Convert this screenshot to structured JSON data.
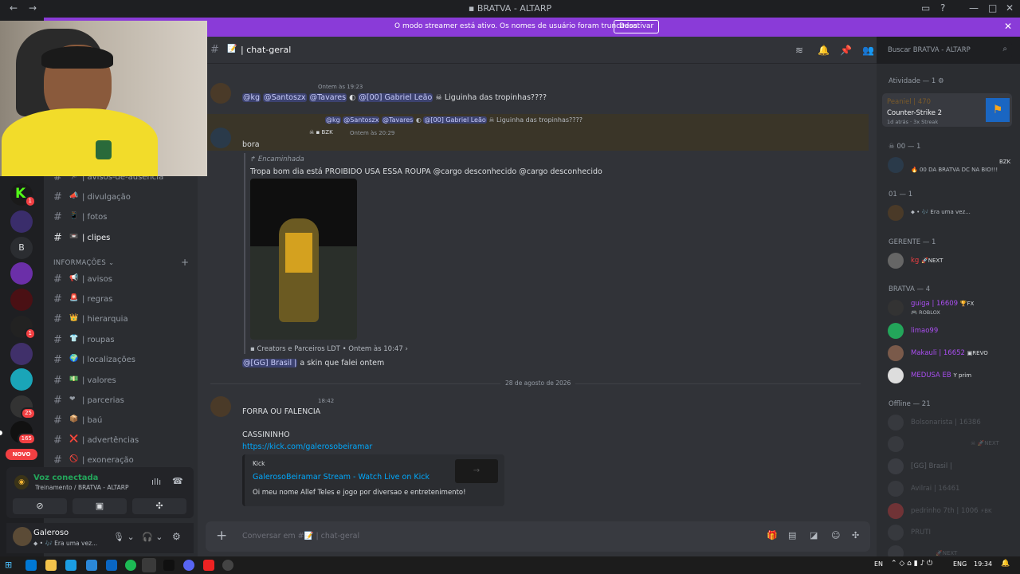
{
  "window": {
    "title": "BRATVA - ALTARP"
  },
  "streamer_banner": {
    "message": "O modo streamer está ativo. Os nomes de usuário foram truncados.",
    "button": "Desativar"
  },
  "servers": {
    "novo_badge": "NOVO",
    "b_label": "B",
    "badges": [
      "1",
      "1",
      "25",
      "165",
      "413"
    ]
  },
  "channels": [
    {
      "emoji": "🏃",
      "label": "| avisos-de-ausência"
    },
    {
      "emoji": "📣",
      "label": "| divulgação"
    },
    {
      "emoji": "📱",
      "label": "| fotos"
    },
    {
      "emoji": "📼",
      "label": "| clipes"
    }
  ],
  "category_info": "INFORMAÇÕES",
  "info_channels": [
    {
      "emoji": "📢",
      "label": "| avisos"
    },
    {
      "emoji": "🚨",
      "label": "| regras"
    },
    {
      "emoji": "👑",
      "label": "| hierarquia"
    },
    {
      "emoji": "👕",
      "label": "| roupas"
    },
    {
      "emoji": "🌍",
      "label": "| localizações"
    },
    {
      "emoji": "💵",
      "label": "| valores"
    },
    {
      "emoji": "❤",
      "label": "| parcerias"
    },
    {
      "emoji": "📦",
      "label": "| baú"
    },
    {
      "emoji": "❌",
      "label": "| advertências"
    },
    {
      "emoji": "🚫",
      "label": "| exoneração"
    }
  ],
  "voice": {
    "title": "Voz conectada",
    "subtitle": "Treinamento / BRATVA - ALTARP"
  },
  "user": {
    "name": "Galeroso",
    "status": "Era uma vez..."
  },
  "channel_header": {
    "name": "| chat-geral",
    "search_placeholder": "Buscar BRATVA - ALTARP"
  },
  "messages": {
    "m1": {
      "time": "Ontem às 19:23",
      "mentions": [
        "@kg",
        "@Santoszx",
        "@Tavares",
        "@[00] Gabriel Leão"
      ],
      "text": "Liguinha das tropinhas????"
    },
    "reply": {
      "mentions": [
        "@kg",
        "@Santoszx",
        "@Tavares",
        "@[00] Gabriel Leão"
      ],
      "text": "Liguinha das tropinhas????"
    },
    "m2": {
      "tag": "BZK",
      "time": "Ontem às 20:29",
      "text": "bora"
    },
    "forward": {
      "label": "Encaminhada",
      "text": "Tropa bom dia está PROIBIDO USA ESSA ROUPA @cargo desconhecido @cargo desconhecido",
      "source": "Creators e Parceiros LDT • Ontem às 10:47"
    },
    "m3": {
      "mention": "@[GG] Brasil |",
      "text": "a skin que falei ontem"
    },
    "divider": "28 de agosto de 2026",
    "m4": {
      "time": "18:42",
      "line1": "FORRA OU FALENCIA",
      "line2": "CASSININHO",
      "link": "https://kick.com/galerosobeiramar"
    },
    "embed": {
      "provider": "Kick",
      "title": "GalerosoBeiramar Stream - Watch Live on Kick",
      "desc": "Oi meu nome Allef Teles e jogo por diversao e entretenimento!"
    }
  },
  "composer": {
    "placeholder": "Conversar em #📝 | chat-geral"
  },
  "members": {
    "activity_header": "Atividade — 1",
    "activity": {
      "user": "Peaniel | 470",
      "game": "Counter-Strike 2",
      "meta": "1d atrás · 3x Streak"
    },
    "groups": [
      {
        "header": "00 — 1",
        "members": [
          {
            "name": "",
            "tag": "BZK",
            "status": "00 DA BRATVA DC NA BIO!!!"
          }
        ]
      },
      {
        "header": "01 — 1",
        "members": [
          {
            "name": "",
            "status": "Era uma vez..."
          }
        ]
      },
      {
        "header": "GERENTE — 1",
        "members": [
          {
            "name": "kg",
            "tag": "NEXT"
          }
        ]
      },
      {
        "header": "BRATVA — 4",
        "members": [
          {
            "name": "guiga | 16609",
            "tag": "FX",
            "status": "ROBLOX"
          },
          {
            "name": "limao99"
          },
          {
            "name": "Makauli | 16652",
            "tag": "REVO"
          },
          {
            "name": "MEDUSA EB",
            "tag": "prim"
          }
        ]
      },
      {
        "header": "Offline — 21",
        "members": [
          {
            "name": "Bolsonarista | 16386"
          },
          {
            "name": "",
            "tag": "NEXT"
          },
          {
            "name": "[GG] Brasil |"
          },
          {
            "name": "Avilrai | 16461"
          },
          {
            "name": "pedrinho 7th | 1006",
            "tag": "BK"
          },
          {
            "name": "PRUTI"
          },
          {
            "name": "",
            "tag": "NEXT"
          }
        ]
      }
    ]
  },
  "taskbar": {
    "lang": "EN",
    "kbd": "ENG",
    "time": "19:34"
  }
}
